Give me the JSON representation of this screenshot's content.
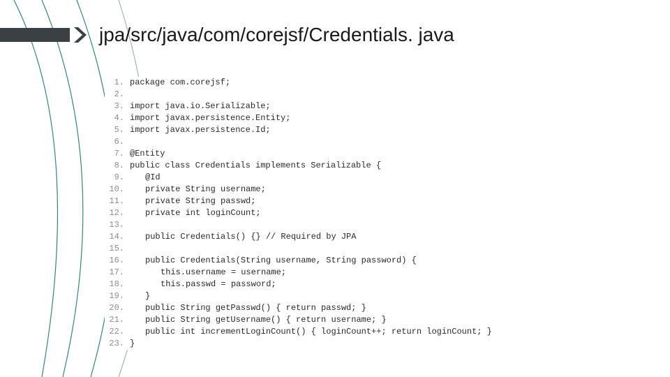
{
  "title": "jpa/src/java/com/corejsf/Credentials. java",
  "code": {
    "lines": [
      {
        "n": 1,
        "indent": 0,
        "text": "package com.corejsf;"
      },
      {
        "n": 2,
        "indent": 0,
        "text": ""
      },
      {
        "n": 3,
        "indent": 0,
        "text": "import java.io.Serializable;"
      },
      {
        "n": 4,
        "indent": 0,
        "text": "import javax.persistence.Entity;"
      },
      {
        "n": 5,
        "indent": 0,
        "text": "import javax.persistence.Id;"
      },
      {
        "n": 6,
        "indent": 0,
        "text": ""
      },
      {
        "n": 7,
        "indent": 0,
        "text": "@Entity"
      },
      {
        "n": 8,
        "indent": 0,
        "text": "public class Credentials implements Serializable {"
      },
      {
        "n": 9,
        "indent": 1,
        "text": "@Id"
      },
      {
        "n": 10,
        "indent": 1,
        "text": "private String username;"
      },
      {
        "n": 11,
        "indent": 1,
        "text": "private String passwd;"
      },
      {
        "n": 12,
        "indent": 1,
        "text": "private int loginCount;"
      },
      {
        "n": 13,
        "indent": 0,
        "text": ""
      },
      {
        "n": 14,
        "indent": 1,
        "text": "public Credentials() {} // Required by JPA"
      },
      {
        "n": 15,
        "indent": 0,
        "text": ""
      },
      {
        "n": 16,
        "indent": 1,
        "text": "public Credentials(String username, String password) {"
      },
      {
        "n": 17,
        "indent": 2,
        "text": "this.username = username;"
      },
      {
        "n": 18,
        "indent": 2,
        "text": "this.passwd = password;"
      },
      {
        "n": 19,
        "indent": 1,
        "text": "}"
      },
      {
        "n": 20,
        "indent": 1,
        "text": "public String getPasswd() { return passwd; }"
      },
      {
        "n": 21,
        "indent": 1,
        "text": "public String getUsername() { return username; }"
      },
      {
        "n": 22,
        "indent": 1,
        "text": "public int incrementLoginCount() { loginCount++; return loginCount; }"
      },
      {
        "n": 23,
        "indent": 0,
        "text": "}"
      }
    ]
  }
}
